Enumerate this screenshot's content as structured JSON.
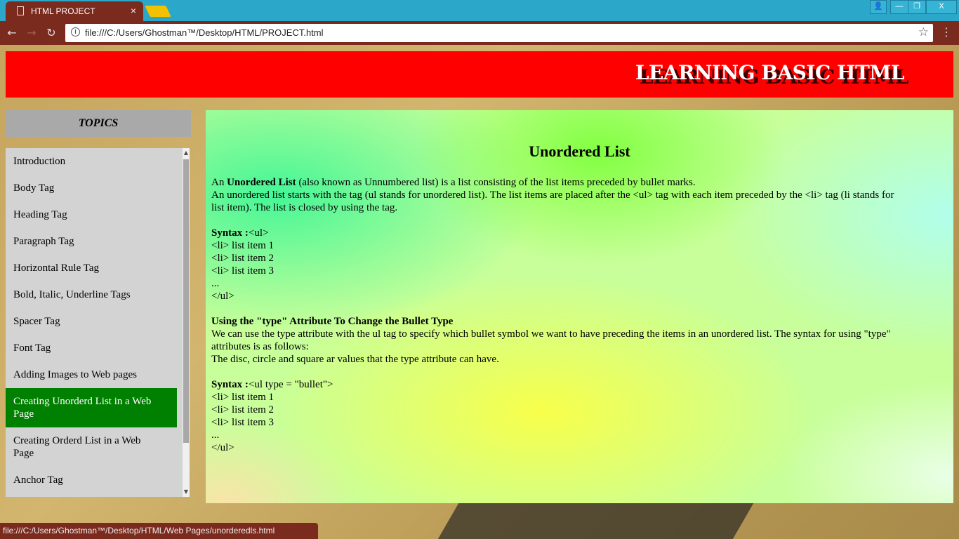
{
  "browser": {
    "tab_title": "HTML PROJECT",
    "tab_close": "×",
    "url": "file:///C:/Users/Ghostman™/Desktop/HTML/PROJECT.html",
    "window_buttons": {
      "user": "👤",
      "minimize": "—",
      "restore": "❐",
      "close": "X"
    },
    "nav_icons": {
      "back": "←",
      "forward": "→",
      "reload": "↻",
      "info": "i",
      "star": "☆",
      "menu": "⋮"
    },
    "status_url": "file:///C:/Users/Ghostman™/Desktop/HTML/Web Pages/unorderedls.html"
  },
  "header": {
    "title": "LEARNING BASIC HTML"
  },
  "sidebar": {
    "title": "TOPICS",
    "items": [
      {
        "label": "Introduction"
      },
      {
        "label": "Body Tag"
      },
      {
        "label": "Heading Tag"
      },
      {
        "label": "Paragraph Tag"
      },
      {
        "label": "Horizontal Rule Tag"
      },
      {
        "label": "Bold, Italic, Underline Tags"
      },
      {
        "label": "Spacer Tag"
      },
      {
        "label": "Font Tag"
      },
      {
        "label": "Adding Images to Web pages"
      },
      {
        "label": "Creating Unorderd List in a Web Page",
        "active": true
      },
      {
        "label": "Creating Orderd List in a Web Page"
      },
      {
        "label": "Anchor Tag"
      }
    ]
  },
  "content": {
    "heading": "Unordered List",
    "intro": {
      "l1_pre": "An ",
      "l1_bold": "Unordered List",
      "l1_post": " (also known as Unnumbered list) is a list consisting of the list items preceded by bullet marks.",
      "l2": "An unordered list starts with the tag (ul stands for unordered list). The list items are placed after the <ul> tag with each item preceded by the <li> tag (li stands for",
      "l3": "list item). The list is closed by using the tag."
    },
    "syntax1": {
      "label": "Syntax :",
      "first": "<ul>",
      "lines": [
        "<li> list item 1",
        "<li> list item 2",
        "<li> list item 3",
        "...",
        "</ul>"
      ]
    },
    "type_section": {
      "heading": "Using the \"type\" Attribute To Change the Bullet Type",
      "l1": "We can use the type attribute with the ul tag to specify which bullet symbol we want to have preceding the items in an unordered list. The syntax for using \"type\"",
      "l2": "attributes is as follows:",
      "l3": "The disc, circle and square ar values that the type attribute can have."
    },
    "syntax2": {
      "label": "Syntax :",
      "first": "<ul type = \"bullet\">",
      "lines": [
        "<li> list item 1",
        "<li> list item 2",
        "<li> list item 3",
        "...",
        "</ul>"
      ]
    }
  }
}
